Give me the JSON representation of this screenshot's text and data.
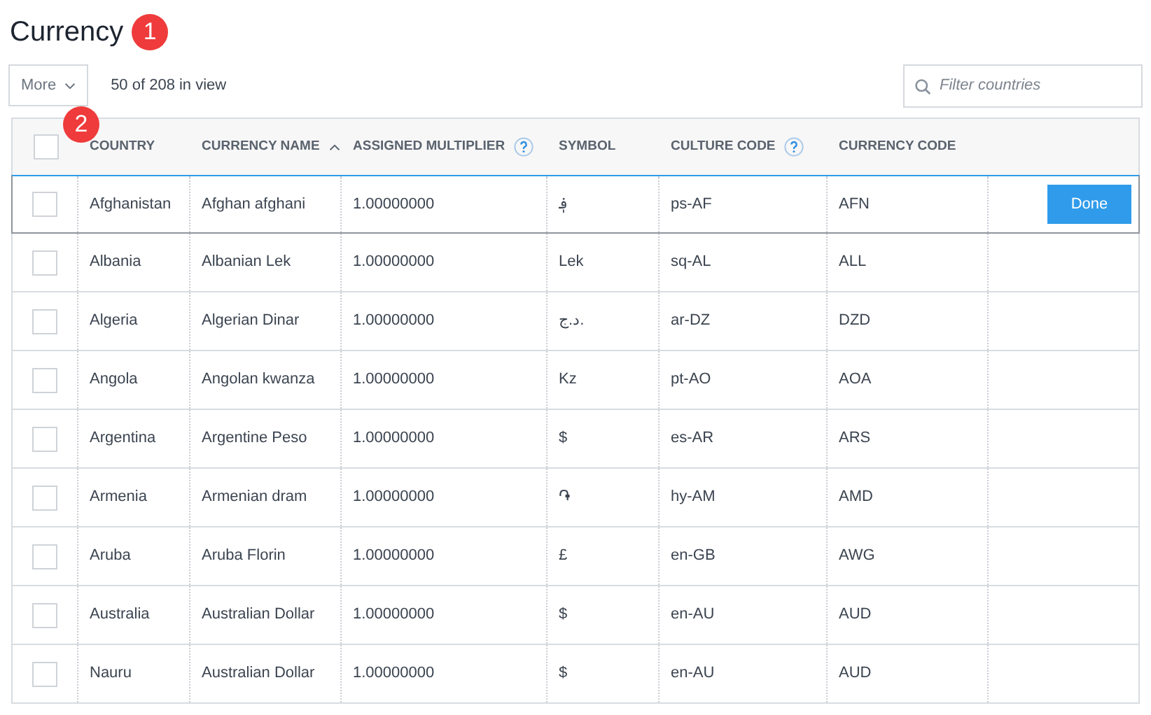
{
  "title": "Currency",
  "title_badge": "1",
  "more_button": "More",
  "more_badge": "2",
  "count": "50 of 208 in view",
  "search": {
    "placeholder": "Filter countries"
  },
  "table": {
    "select_all": {
      "checked": false
    },
    "columns": [
      {
        "label": "COUNTRY",
        "sorted": false,
        "help": false
      },
      {
        "label": "CURRENCY NAME",
        "sorted": true,
        "help": false
      },
      {
        "label": "ASSIGNED MULTIPLIER",
        "sorted": false,
        "help": true
      },
      {
        "label": "SYMBOL",
        "sorted": false,
        "help": false
      },
      {
        "label": "CULTURE CODE",
        "sorted": false,
        "help": true
      },
      {
        "label": "CURRENCY CODE",
        "sorted": false,
        "help": false
      }
    ],
    "rows": [
      {
        "checked": false,
        "editing": true,
        "action": "Done",
        "cells": [
          "Afghanistan",
          "Afghan afghani",
          "1.00000000",
          "؋",
          "ps-AF",
          "AFN"
        ]
      },
      {
        "checked": false,
        "editing": false,
        "cells": [
          "Albania",
          "Albanian Lek",
          "1.00000000",
          "Lek",
          "sq-AL",
          "ALL"
        ]
      },
      {
        "checked": false,
        "editing": false,
        "cells": [
          "Algeria",
          "Algerian Dinar",
          "1.00000000",
          "د.ج.",
          "ar-DZ",
          "DZD"
        ]
      },
      {
        "checked": false,
        "editing": false,
        "cells": [
          "Angola",
          "Angolan kwanza",
          "1.00000000",
          "Kz",
          "pt-AO",
          "AOA"
        ]
      },
      {
        "checked": false,
        "editing": false,
        "cells": [
          "Argentina",
          "Argentine Peso",
          "1.00000000",
          "$",
          "es-AR",
          "ARS"
        ]
      },
      {
        "checked": false,
        "editing": false,
        "cells": [
          "Armenia",
          "Armenian dram",
          "1.00000000",
          "֏",
          "hy-AM",
          "AMD"
        ]
      },
      {
        "checked": false,
        "editing": false,
        "cells": [
          "Aruba",
          "Aruba Florin",
          "1.00000000",
          "£",
          "en-GB",
          "AWG"
        ]
      },
      {
        "checked": false,
        "editing": false,
        "cells": [
          "Australia",
          "Australian Dollar",
          "1.00000000",
          "$",
          "en-AU",
          "AUD"
        ]
      },
      {
        "checked": false,
        "editing": false,
        "cells": [
          "Nauru",
          "Australian Dollar",
          "1.00000000",
          "$",
          "en-AU",
          "AUD"
        ]
      }
    ]
  }
}
